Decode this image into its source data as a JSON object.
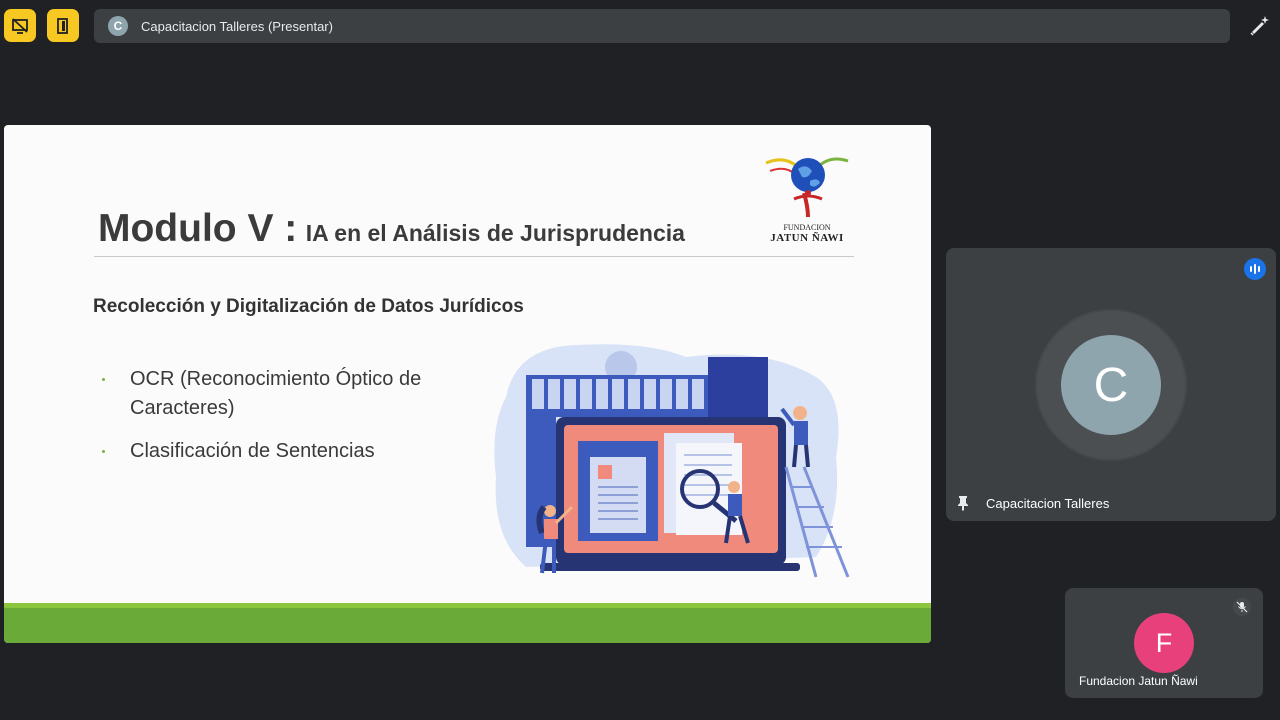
{
  "meeting": {
    "title": "Capacitacion Talleres (Presentar)",
    "avatar_letter": "C"
  },
  "slide": {
    "title_main": "Modulo V :",
    "title_sub": "IA en el Análisis de Jurisprudencia",
    "subtitle": "Recolección y Digitalización de Datos Jurídicos",
    "bullets": [
      "OCR (Reconocimiento Óptico de Caracteres)",
      "Clasificación de Sentencias"
    ],
    "logo_line1": "FUNDACION",
    "logo_line2": "JATUN ÑAWI"
  },
  "participants": [
    {
      "name": "Capacitacion Talleres",
      "letter": "C",
      "avatar_color": "#8fa5ad",
      "speaking": true,
      "pinned": true
    },
    {
      "name": "Fundacion Jatun Ñawi",
      "letter": "F",
      "avatar_color": "#e8407a",
      "muted": true
    }
  ],
  "icons": {
    "toolbar": [
      "present-off-icon",
      "door-icon"
    ],
    "edit": "pen-sparkle-icon"
  },
  "colors": {
    "accent_yellow": "#f8c822",
    "slide_green": "#6aaa38",
    "speaking_blue": "#1a73e8"
  }
}
